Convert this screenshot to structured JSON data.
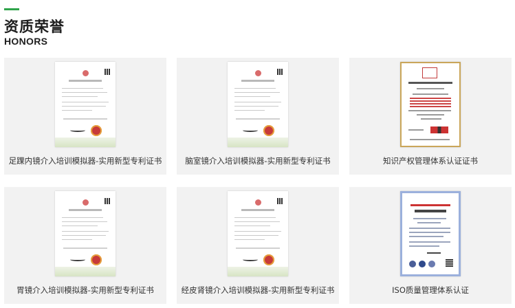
{
  "header": {
    "title_cn": "资质荣誉",
    "title_en": "HONORS",
    "accent_color": "#2fa34a"
  },
  "honors": [
    {
      "caption": "足踝内镜介入培训模拟器-实用新型专利证书",
      "type": "patent-certificate"
    },
    {
      "caption": "脑室镜介入培训模拟器-实用新型专利证书",
      "type": "patent-certificate"
    },
    {
      "caption": "知识产权管理体系认证证书",
      "type": "ip-management-certificate"
    },
    {
      "caption": "胃镜介入培训模拟器-实用新型专利证书",
      "type": "patent-certificate"
    },
    {
      "caption": "经皮肾镜介入培训模拟器-实用新型专利证书",
      "type": "patent-certificate"
    },
    {
      "caption": "ISO质量管理体系认证",
      "type": "iso-certificate"
    }
  ]
}
